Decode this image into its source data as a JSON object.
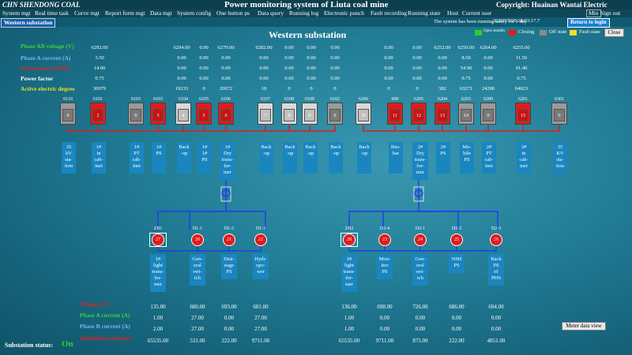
{
  "header": {
    "company": "CHN SHENDONG COAL",
    "title": "Power monitoring system of Liuta coal mine",
    "copyright": "Copyright: Huainan Wantai Electric"
  },
  "menu": [
    "System mgt",
    "Real time task",
    "Curve mgt",
    "Report form mgt",
    "Data mgt",
    "System config",
    "One button ps",
    "Data query",
    "Running log",
    "Electronic punch",
    "Fault recording",
    "Running state",
    "Host",
    "Current user"
  ],
  "datetime": "2020/07/09  18:03:17.7",
  "window": {
    "min": "Min",
    "signout": "Sign out",
    "return": "Return to login"
  },
  "tab": "Western substation",
  "status_msg": "The system has been running safely for 1 day",
  "page_title": "Western substation",
  "legend": {
    "open": "Open standby",
    "closing": "Closing",
    "off": "Off state",
    "fault": "Fault state",
    "close": "Close"
  },
  "colors": {
    "red": "#e21b1b",
    "gray": "#8a8a8a",
    "light": "#c9c9c9",
    "blue": "#1a86c0",
    "green": "#2bd12b"
  },
  "top_labels": [
    "Phase AB voltage (V)",
    "Phase A current (A)",
    "Active power (KW)",
    "Power factor",
    "Active electric degree"
  ],
  "top_values": [
    [
      "6292.00",
      "",
      "6294.00",
      "0.00",
      "6279.00",
      "6282.00",
      "0.00",
      "0.00",
      "0.00",
      "",
      "0.00",
      "0.00",
      "6252.00",
      "6259.00",
      "6264.00",
      "",
      "6255.00"
    ],
    [
      "3.50",
      "",
      "0.00",
      "0.00",
      "0.00",
      "0.00",
      "0.00",
      "0.00",
      "0.00",
      "",
      "0.00",
      "0.00",
      "0.00",
      "8.50",
      "0.00",
      "",
      "11.50"
    ],
    [
      "14.00",
      "",
      "0.00",
      "0.00",
      "0.00",
      "0.00",
      "0.00",
      "0.00",
      "0.00",
      "",
      "0.00",
      "0.00",
      "0.00",
      "54.90",
      "0.00",
      "",
      "91.40"
    ],
    [
      "0.75",
      "",
      "0.00",
      "0.00",
      "0.00",
      "0.00",
      "0.00",
      "0.00",
      "0.00",
      "",
      "0.00",
      "0.00",
      "0.00",
      "0.75",
      "0.00",
      "",
      "0.75"
    ],
    [
      "36979",
      "",
      "19233",
      "0",
      "20072",
      "18",
      "0",
      "0",
      "0",
      "",
      "0",
      "0",
      "382",
      "63271",
      "24280",
      "",
      "64823"
    ]
  ],
  "switches": [
    {
      "id": "6110",
      "n": "0",
      "tag": "35 kV sta- tion"
    },
    {
      "id": "6101",
      "n": "2",
      "tag": "1# in cab- inet"
    },
    {
      "id": "6103",
      "n": "0",
      "tag": "1# PT cab- inet"
    },
    {
      "id": "6103",
      "n": "3",
      "tag": "1# PS"
    },
    {
      "id": "6104",
      "n": "4",
      "tag": "Back -up"
    },
    {
      "id": "6105",
      "n": "5",
      "tag": "1# 1# PS"
    },
    {
      "id": "6106",
      "n": "6",
      "tag": "1# Dry trans- for- mer"
    },
    {
      "id": "6107",
      "n": "7",
      "tag": "Back -up"
    },
    {
      "id": "6108",
      "n": "8",
      "tag": "Back -up"
    },
    {
      "id": "6109",
      "n": "9",
      "tag": "Back -up"
    },
    {
      "id": "6102",
      "n": "0",
      "tag": "Back -up"
    },
    {
      "id": "6206",
      "n": "10",
      "tag": "Back -up"
    },
    {
      "id": "600",
      "n": "11",
      "tag": "Bus- bar"
    },
    {
      "id": "6205",
      "n": "12",
      "tag": "2# Dry trans- for- mer"
    },
    {
      "id": "6204",
      "n": "13",
      "tag": "2# PS"
    },
    {
      "id": "6203",
      "n": "14",
      "tag": "Mo- bile PS"
    },
    {
      "id": "6289",
      "n": "0",
      "tag": "2# PT cab- inet"
    },
    {
      "id": "6201",
      "n": "15",
      "tag": "2# in cab- inet"
    },
    {
      "id": "6301",
      "n": "0",
      "tag": "35 KV sta- tion"
    }
  ],
  "bottom_nodes": [
    {
      "id": "ZB1",
      "n": "27",
      "tag": "1# light trans- for- mer"
    },
    {
      "id": "D1-1",
      "n": "20",
      "tag": "Gen- eral swi- tch"
    },
    {
      "id": "D1-2",
      "n": "21",
      "tag": "Drai- nage PS"
    },
    {
      "id": "D1-3",
      "n": "22",
      "tag": "Hydr- opo- wer"
    },
    {
      "id": "ZB2",
      "n": "28",
      "tag": "2# light trans- for- mer"
    },
    {
      "id": "D2-4",
      "n": "23",
      "tag": "Mon- itor PS"
    },
    {
      "id": "D2-1",
      "n": "24",
      "tag": "Gen- eral swi- tch"
    },
    {
      "id": "D2-2",
      "n": "25",
      "tag": "NIM PS"
    },
    {
      "id": "D2-3",
      "n": "26",
      "tag": "Back PS of PHS"
    }
  ],
  "bottom_labels": [
    "Voltage (V)",
    "Phase A current (A)",
    "Phase B current (A)",
    "Insulation resistance"
  ],
  "bottom_values": [
    [
      "135.00",
      "680.00",
      "693.00",
      "681.00",
      "136.00",
      "698.00",
      "726.00",
      "686.00",
      "694.00"
    ],
    [
      "1.00",
      "27.00",
      "0.00",
      "27.00",
      "1.00",
      "0.00",
      "0.00",
      "0.00",
      "0.00"
    ],
    [
      "2.00",
      "27.00",
      "0.00",
      "27.00",
      "1.00",
      "0.00",
      "0.00",
      "0.00",
      "0.00"
    ],
    [
      "65535.00",
      "531.00",
      "222.00",
      "9711.00",
      "65535.00",
      "9711.00",
      "875.00",
      "222.00",
      "4851.00"
    ]
  ],
  "meter_btn": "Meter data view",
  "status": {
    "label": "Substation status:",
    "value": "On"
  }
}
